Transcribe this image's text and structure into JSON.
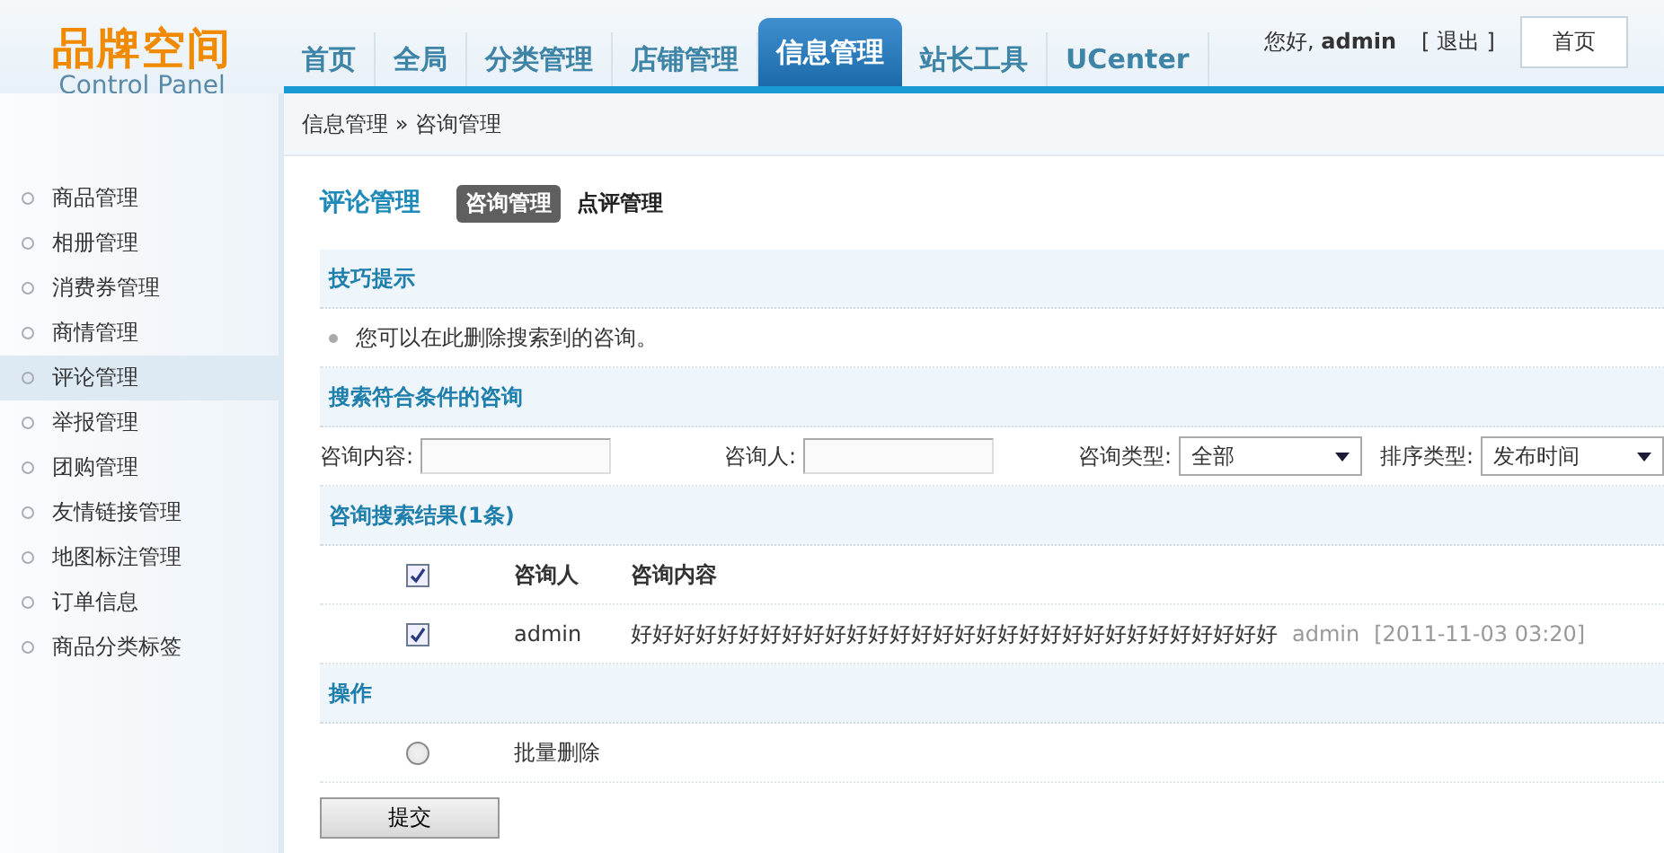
{
  "logo": {
    "title": "品牌空间",
    "subtitle": "Control Panel"
  },
  "nav": [
    {
      "label": "首页",
      "selected": false
    },
    {
      "label": "全局",
      "selected": false
    },
    {
      "label": "分类管理",
      "selected": false
    },
    {
      "label": "店铺管理",
      "selected": false
    },
    {
      "label": "信息管理",
      "selected": true
    },
    {
      "label": "站长工具",
      "selected": false
    },
    {
      "label": "UCenter",
      "selected": false
    }
  ],
  "user": {
    "greeting": "您好,",
    "name": "admin",
    "logout": "[ 退出 ]"
  },
  "home_button": "首页",
  "breadcrumb": "信息管理 » 咨询管理",
  "sidebar": [
    {
      "label": "商品管理",
      "selected": false
    },
    {
      "label": "相册管理",
      "selected": false
    },
    {
      "label": "消费券管理",
      "selected": false
    },
    {
      "label": "商情管理",
      "selected": false
    },
    {
      "label": "评论管理",
      "selected": true
    },
    {
      "label": "举报管理",
      "selected": false
    },
    {
      "label": "团购管理",
      "selected": false
    },
    {
      "label": "友情链接管理",
      "selected": false
    },
    {
      "label": "地图标注管理",
      "selected": false
    },
    {
      "label": "订单信息",
      "selected": false
    },
    {
      "label": "商品分类标签",
      "selected": false
    }
  ],
  "page": {
    "title": "评论管理",
    "tabs": [
      {
        "label": "咨询管理",
        "selected": true
      },
      {
        "label": "点评管理",
        "selected": false
      }
    ]
  },
  "tips": {
    "title": "技巧提示",
    "items": [
      "您可以在此删除搜索到的咨询。"
    ]
  },
  "search": {
    "title": "搜索符合条件的咨询",
    "fields": [
      {
        "kind": "text",
        "label": "咨询内容:"
      },
      {
        "kind": "text",
        "label": "咨询人:"
      },
      {
        "kind": "select",
        "label": "咨询类型:",
        "value": "全部"
      },
      {
        "kind": "select",
        "label": "排序类型:",
        "value": "发布时间"
      }
    ]
  },
  "results": {
    "title": "咨询搜索结果(1条)",
    "header_checked": true,
    "columns": [
      "咨询人",
      "咨询内容"
    ],
    "rows": [
      {
        "checked": true,
        "author": "admin",
        "content": "好好好好好好好好好好好好好好好好好好好好好好好好好好好好好好",
        "poster": "admin",
        "time": "[2011-11-03 03:20]"
      }
    ]
  },
  "operations": {
    "title": "操作",
    "items": [
      {
        "label": "批量删除",
        "selected": false
      }
    ]
  },
  "submit": "提交"
}
